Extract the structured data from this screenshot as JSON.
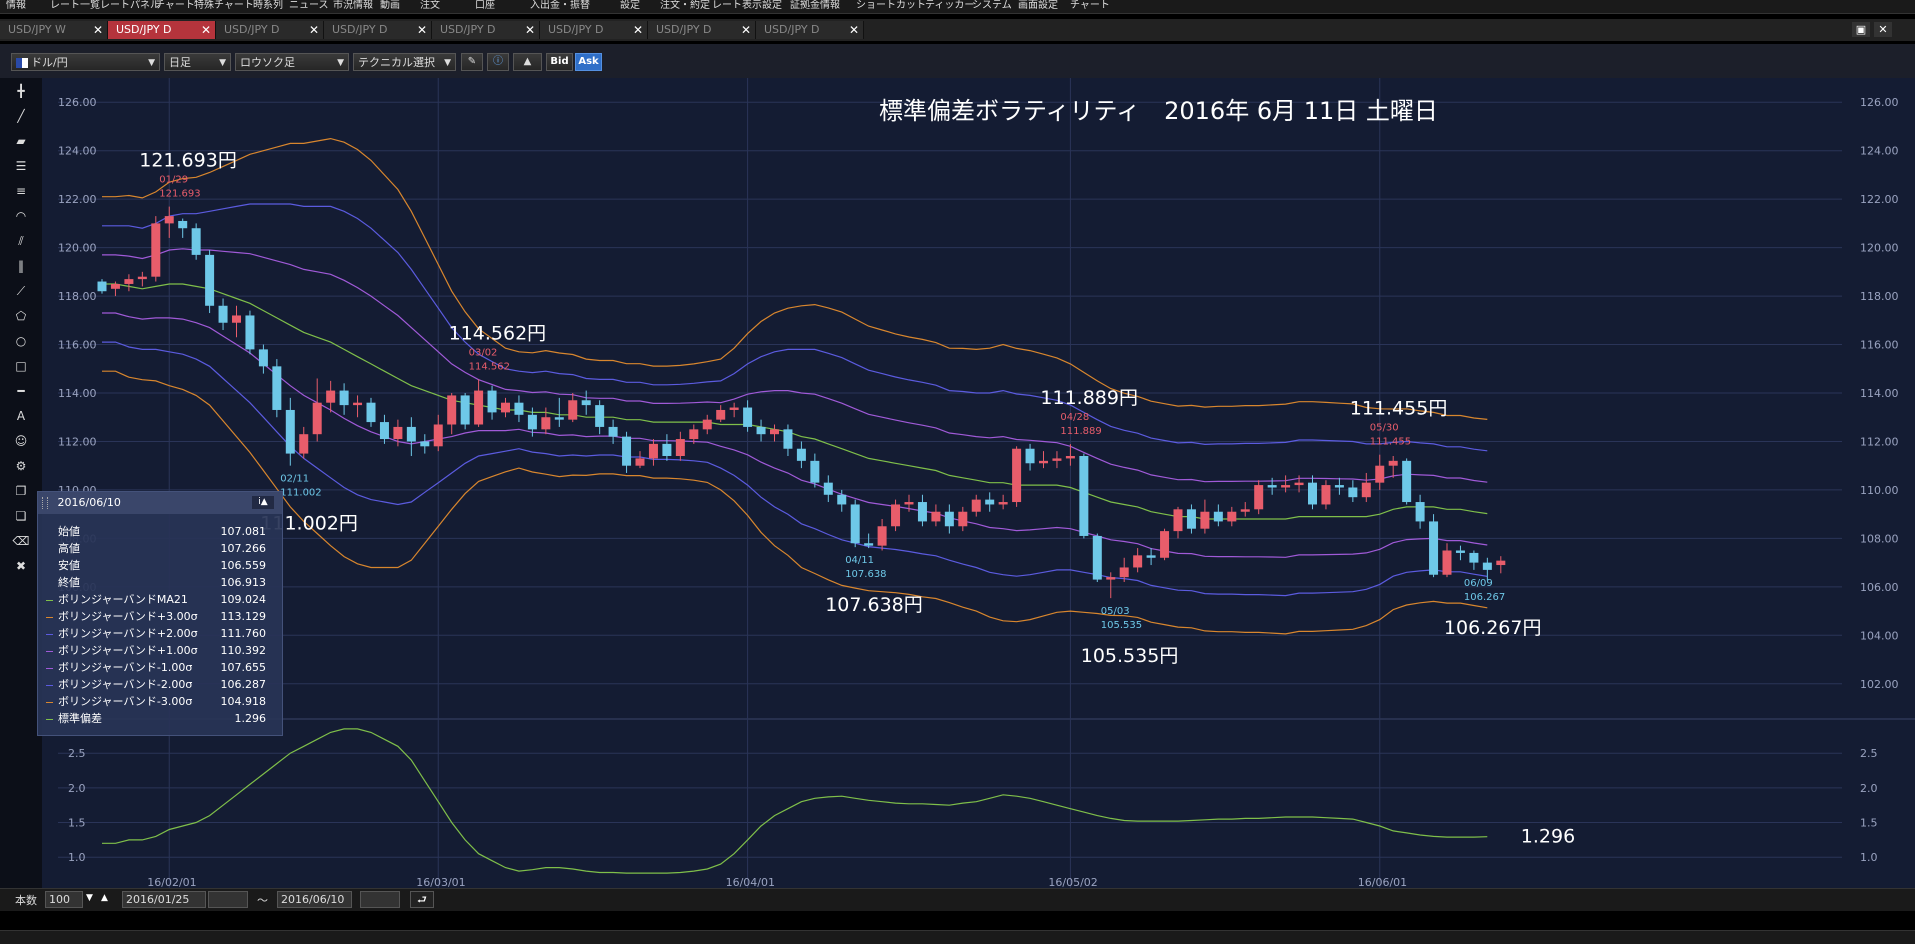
{
  "menubar": {
    "items": [
      "情報",
      "レート一覧",
      "レートパネル",
      "チャート",
      "特殊チャート",
      "時系列",
      "ニュース",
      "市況情報",
      "動画",
      "注文",
      "口座",
      "入出金・振替",
      "設定",
      "注文・約定",
      "レート表示設定",
      "証拠金情報",
      "ショートカット",
      "ティッカー",
      "システム",
      "画面設定",
      "チャート"
    ]
  },
  "tabs": [
    {
      "label": "USD/JPY W",
      "active": false
    },
    {
      "label": "USD/JPY D",
      "active": true
    },
    {
      "label": "USD/JPY D",
      "active": false
    },
    {
      "label": "USD/JPY D",
      "active": false
    },
    {
      "label": "USD/JPY D",
      "active": false
    },
    {
      "label": "USD/JPY D",
      "active": false
    },
    {
      "label": "USD/JPY D",
      "active": false
    },
    {
      "label": "USD/JPY D",
      "active": false
    }
  ],
  "toolbar": {
    "pair": "ドル/円",
    "timeframe": "日足",
    "chart_type": "ロウソク足",
    "technical": "テクニカル選択",
    "bid": "Bid",
    "ask": "Ask"
  },
  "chart_data": {
    "type": "candlestick",
    "title": "標準偏差ボラティリティ　2016年 6月 11日 土曜日",
    "y_ticks": [
      "126.00",
      "124.00",
      "122.00",
      "120.00",
      "118.00",
      "116.00",
      "114.00",
      "112.00",
      "110.00",
      "108.00",
      "106.00",
      "104.00",
      "102.00"
    ],
    "ylim": [
      101.0,
      127.0
    ],
    "sub_y_ticks": [
      "2.5",
      "2.0",
      "1.5",
      "1.0"
    ],
    "sub_ylim": [
      0.7,
      2.95
    ],
    "x_ticks": [
      "16/02/01",
      "16/03/01",
      "16/04/01",
      "16/05/02",
      "16/06/01"
    ],
    "candles": [
      [
        118.6,
        118.2,
        118.7,
        118.1
      ],
      [
        118.3,
        118.5,
        118.6,
        118.0
      ],
      [
        118.5,
        118.7,
        118.9,
        118.2
      ],
      [
        118.7,
        118.8,
        119.0,
        118.4
      ],
      [
        118.8,
        121.0,
        121.3,
        118.6
      ],
      [
        121.0,
        121.3,
        121.693,
        120.4
      ],
      [
        121.1,
        120.8,
        121.2,
        120.4
      ],
      [
        120.8,
        119.7,
        121.0,
        119.5
      ],
      [
        119.7,
        117.6,
        119.9,
        117.3
      ],
      [
        117.6,
        116.9,
        117.9,
        116.6
      ],
      [
        116.9,
        117.2,
        117.6,
        116.3
      ],
      [
        117.2,
        115.8,
        117.4,
        115.6
      ],
      [
        115.8,
        115.1,
        116.0,
        114.8
      ],
      [
        115.1,
        113.3,
        115.4,
        113.0
      ],
      [
        113.3,
        111.5,
        113.8,
        111.002
      ],
      [
        111.5,
        112.3,
        112.6,
        111.3
      ],
      [
        112.3,
        113.6,
        114.6,
        112.0
      ],
      [
        113.6,
        114.1,
        114.5,
        113.2
      ],
      [
        114.1,
        113.5,
        114.4,
        113.1
      ],
      [
        113.5,
        113.6,
        113.9,
        113.0
      ],
      [
        113.6,
        112.8,
        113.8,
        112.6
      ],
      [
        112.8,
        112.1,
        113.1,
        111.9
      ],
      [
        112.1,
        112.6,
        112.9,
        111.8
      ],
      [
        112.6,
        112.0,
        113.0,
        111.4
      ],
      [
        112.0,
        111.8,
        112.3,
        111.5
      ],
      [
        111.8,
        112.7,
        113.1,
        111.6
      ],
      [
        112.7,
        113.9,
        114.0,
        112.3
      ],
      [
        113.9,
        112.7,
        114.0,
        112.5
      ],
      [
        112.7,
        114.1,
        114.562,
        112.6
      ],
      [
        114.1,
        113.2,
        114.3,
        112.9
      ],
      [
        113.2,
        113.6,
        113.8,
        113.0
      ],
      [
        113.6,
        113.1,
        113.9,
        112.8
      ],
      [
        113.1,
        112.5,
        113.4,
        112.2
      ],
      [
        112.5,
        113.0,
        113.4,
        112.3
      ],
      [
        113.0,
        112.9,
        113.8,
        112.6
      ],
      [
        112.9,
        113.7,
        114.0,
        112.8
      ],
      [
        113.7,
        113.5,
        114.1,
        113.1
      ],
      [
        113.5,
        112.6,
        113.7,
        112.3
      ],
      [
        112.6,
        112.2,
        112.9,
        111.9
      ],
      [
        112.2,
        111.0,
        112.4,
        110.7
      ],
      [
        111.0,
        111.3,
        111.6,
        110.9
      ],
      [
        111.3,
        111.9,
        112.1,
        111.0
      ],
      [
        111.9,
        111.4,
        112.3,
        111.2
      ],
      [
        111.4,
        112.1,
        112.4,
        111.2
      ],
      [
        112.1,
        112.5,
        112.7,
        111.9
      ],
      [
        112.5,
        112.9,
        113.1,
        112.3
      ],
      [
        112.9,
        113.3,
        113.5,
        112.8
      ],
      [
        113.3,
        113.4,
        113.6,
        113.0
      ],
      [
        113.4,
        112.6,
        113.7,
        112.4
      ],
      [
        112.6,
        112.3,
        112.9,
        112.0
      ],
      [
        112.3,
        112.5,
        112.7,
        112.0
      ],
      [
        112.5,
        111.7,
        112.7,
        111.4
      ],
      [
        111.7,
        111.2,
        112.0,
        110.9
      ],
      [
        111.2,
        110.3,
        111.5,
        110.1
      ],
      [
        110.3,
        109.8,
        110.6,
        109.5
      ],
      [
        109.8,
        109.4,
        110.0,
        109.1
      ],
      [
        109.4,
        107.8,
        109.6,
        107.638
      ],
      [
        107.8,
        107.7,
        108.2,
        107.6
      ],
      [
        107.7,
        108.5,
        108.8,
        107.5
      ],
      [
        108.5,
        109.4,
        109.6,
        108.3
      ],
      [
        109.4,
        109.5,
        109.8,
        109.1
      ],
      [
        109.5,
        108.7,
        109.8,
        108.5
      ],
      [
        108.7,
        109.1,
        109.4,
        108.5
      ],
      [
        109.1,
        108.5,
        109.4,
        108.2
      ],
      [
        108.5,
        109.1,
        109.3,
        108.3
      ],
      [
        109.1,
        109.6,
        109.8,
        108.9
      ],
      [
        109.6,
        109.4,
        109.9,
        109.1
      ],
      [
        109.4,
        109.5,
        109.8,
        109.2
      ],
      [
        109.5,
        111.7,
        111.8,
        109.3
      ],
      [
        111.7,
        111.1,
        111.9,
        110.8
      ],
      [
        111.1,
        111.2,
        111.6,
        110.9
      ],
      [
        111.2,
        111.3,
        111.6,
        110.9
      ],
      [
        111.3,
        111.4,
        111.889,
        111.0
      ],
      [
        111.4,
        108.1,
        111.5,
        108.0
      ],
      [
        108.1,
        106.3,
        108.2,
        106.2
      ],
      [
        106.3,
        106.4,
        106.6,
        105.535
      ],
      [
        106.4,
        106.8,
        107.2,
        106.2
      ],
      [
        106.8,
        107.3,
        107.6,
        106.6
      ],
      [
        107.3,
        107.2,
        107.6,
        106.9
      ],
      [
        107.2,
        108.3,
        108.4,
        107.1
      ],
      [
        108.3,
        109.2,
        109.3,
        108.0
      ],
      [
        109.2,
        108.4,
        109.4,
        108.2
      ],
      [
        108.4,
        109.1,
        109.6,
        108.2
      ],
      [
        109.1,
        108.7,
        109.4,
        108.5
      ],
      [
        108.7,
        109.1,
        109.3,
        108.5
      ],
      [
        109.1,
        109.2,
        109.5,
        108.9
      ],
      [
        109.2,
        110.2,
        110.4,
        109.0
      ],
      [
        110.2,
        110.1,
        110.5,
        109.8
      ],
      [
        110.1,
        110.2,
        110.6,
        109.9
      ],
      [
        110.2,
        110.3,
        110.6,
        109.9
      ],
      [
        110.3,
        109.4,
        110.6,
        109.2
      ],
      [
        109.4,
        110.2,
        110.4,
        109.2
      ],
      [
        110.2,
        110.1,
        110.5,
        109.8
      ],
      [
        110.1,
        109.7,
        110.4,
        109.5
      ],
      [
        109.7,
        110.3,
        110.7,
        109.5
      ],
      [
        110.3,
        111.0,
        111.455,
        110.0
      ],
      [
        111.0,
        111.2,
        111.4,
        110.5
      ],
      [
        111.2,
        109.5,
        111.3,
        109.4
      ],
      [
        109.5,
        108.7,
        109.8,
        108.4
      ],
      [
        108.7,
        106.5,
        109.0,
        106.4
      ],
      [
        106.5,
        107.5,
        107.8,
        106.4
      ],
      [
        107.5,
        107.4,
        107.7,
        107.1
      ],
      [
        107.4,
        107.0,
        107.5,
        106.7
      ],
      [
        107.0,
        106.7,
        107.2,
        106.267
      ],
      [
        106.9,
        107.081,
        107.266,
        106.559
      ]
    ],
    "bands": {
      "ma": [
        118.5,
        118.5,
        118.4,
        118.3,
        118.4,
        118.5,
        118.5,
        118.4,
        118.3,
        118.1,
        117.9,
        117.7,
        117.4,
        117.1,
        116.8,
        116.5,
        116.3,
        116.1,
        115.8,
        115.5,
        115.2,
        114.9,
        114.6,
        114.3,
        114.1,
        113.9,
        113.7,
        113.6,
        113.5,
        113.4,
        113.3,
        113.3,
        113.2,
        113.2,
        113.1,
        113.1,
        113.0,
        113.0,
        113.0,
        112.9,
        112.9,
        112.8,
        112.8,
        112.8,
        112.8,
        112.8,
        112.7,
        112.7,
        112.7,
        112.6,
        112.5,
        112.4,
        112.2,
        112.1,
        111.9,
        111.7,
        111.5,
        111.3,
        111.2,
        111.1,
        111.0,
        110.9,
        110.8,
        110.6,
        110.5,
        110.4,
        110.3,
        110.3,
        110.2,
        110.2,
        110.2,
        110.2,
        110.1,
        109.9,
        109.7,
        109.5,
        109.4,
        109.3,
        109.1,
        109.0,
        108.9,
        108.9,
        108.8,
        108.8,
        108.8,
        108.8,
        108.8,
        108.8,
        108.8,
        108.9,
        108.9,
        108.9,
        108.9,
        108.9,
        108.9,
        109.0,
        109.2,
        109.3,
        109.3,
        109.3,
        109.2,
        109.2,
        109.1,
        109.024
      ],
      "sd": [
        1.2,
        1.2,
        1.25,
        1.25,
        1.3,
        1.4,
        1.45,
        1.5,
        1.6,
        1.75,
        1.9,
        2.05,
        2.2,
        2.35,
        2.5,
        2.6,
        2.7,
        2.8,
        2.85,
        2.85,
        2.8,
        2.7,
        2.6,
        2.4,
        2.1,
        1.8,
        1.5,
        1.25,
        1.05,
        0.95,
        0.85,
        0.8,
        0.82,
        0.85,
        0.85,
        0.83,
        0.8,
        0.78,
        0.78,
        0.77,
        0.77,
        0.77,
        0.77,
        0.78,
        0.8,
        0.83,
        0.9,
        1.05,
        1.25,
        1.45,
        1.6,
        1.7,
        1.8,
        1.85,
        1.87,
        1.88,
        1.85,
        1.82,
        1.8,
        1.78,
        1.77,
        1.77,
        1.76,
        1.75,
        1.78,
        1.8,
        1.85,
        1.9,
        1.88,
        1.85,
        1.8,
        1.75,
        1.7,
        1.65,
        1.6,
        1.56,
        1.53,
        1.52,
        1.52,
        1.52,
        1.52,
        1.53,
        1.54,
        1.55,
        1.55,
        1.56,
        1.56,
        1.57,
        1.58,
        1.58,
        1.58,
        1.57,
        1.56,
        1.55,
        1.5,
        1.45,
        1.38,
        1.35,
        1.32,
        1.3,
        1.29,
        1.29,
        1.29,
        1.296
      ],
      "colors": {
        "ma": "#7fbf4a",
        "p3": "#d8862e",
        "p2": "#5b5bdf",
        "p1": "#a05ad8",
        "m1": "#a05ad8",
        "m2": "#5b5bdf",
        "m3": "#d8862e",
        "sd": "#7fbf4a"
      }
    },
    "annotations": [
      {
        "label_big": "121.693円",
        "date": "01/29",
        "value": "121.693",
        "idx": 5,
        "type": "high"
      },
      {
        "label_big": "111.002円",
        "date": "02/11",
        "value": "111.002",
        "idx": 14,
        "type": "low"
      },
      {
        "label_big": "114.562円",
        "date": "03/02",
        "value": "114.562",
        "idx": 28,
        "type": "high"
      },
      {
        "label_big": "107.638円",
        "date": "04/11",
        "value": "107.638",
        "idx": 56,
        "type": "low"
      },
      {
        "label_big": "111.889円",
        "date": "04/28",
        "value": "111.889",
        "idx": 72,
        "type": "high"
      },
      {
        "label_big": "105.535円",
        "date": "05/03",
        "value": "105.535",
        "idx": 75,
        "type": "low"
      },
      {
        "label_big": "111.455円",
        "date": "05/30",
        "value": "111.455",
        "idx": 95,
        "type": "high"
      },
      {
        "label_big": "106.267円",
        "date": "06/09",
        "value": "106.267",
        "idx": 102,
        "type": "low"
      }
    ],
    "sd_last_label": "1.296",
    "candle_up_color": "#e85d6b",
    "candle_down_color": "#6ec8e8"
  },
  "info_panel": {
    "date": "2016/06/10",
    "rows": [
      {
        "label": "始値",
        "value": "107.081",
        "color": ""
      },
      {
        "label": "高値",
        "value": "107.266",
        "color": ""
      },
      {
        "label": "安値",
        "value": "106.559",
        "color": ""
      },
      {
        "label": "終値",
        "value": "106.913",
        "color": ""
      },
      {
        "label": "ボリンジャーバンドMA21",
        "value": "109.024",
        "color": "#7fbf4a"
      },
      {
        "label": "ボリンジャーバンド+3.00σ",
        "value": "113.129",
        "color": "#d8862e"
      },
      {
        "label": "ボリンジャーバンド+2.00σ",
        "value": "111.760",
        "color": "#5b5bdf"
      },
      {
        "label": "ボリンジャーバンド+1.00σ",
        "value": "110.392",
        "color": "#a05ad8"
      },
      {
        "label": "ボリンジャーバンド-1.00σ",
        "value": "107.655",
        "color": "#a05ad8"
      },
      {
        "label": "ボリンジャーバンド-2.00σ",
        "value": "106.287",
        "color": "#5b5bdf"
      },
      {
        "label": "ボリンジャーバンド-3.00σ",
        "value": "104.918",
        "color": "#d8862e"
      },
      {
        "label": "標準偏差",
        "value": "1.296",
        "color": "#7fbf4a"
      }
    ]
  },
  "footer": {
    "count_label": "本数",
    "count_value": "100",
    "date_from": "2016/01/25",
    "separator": "〜",
    "date_to": "2016/06/10"
  }
}
